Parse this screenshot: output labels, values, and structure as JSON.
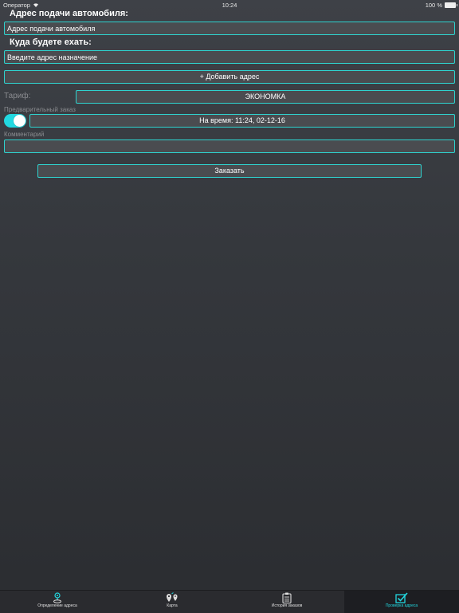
{
  "status_bar": {
    "carrier": "Оператор",
    "time": "10:24",
    "battery": "100 %"
  },
  "form": {
    "pickup_label": "Адрес подачи автомобиля:",
    "pickup_placeholder": "Адрес подачи автомобиля",
    "destination_label": "Куда будете ехать:",
    "destination_placeholder": "Введите адрес назначение",
    "add_address_label": "+ Добавить адрес",
    "tariff_label": "Тариф:",
    "tariff_value": "ЭКОНОМКА",
    "preorder_label": "Предварительный заказ",
    "preorder_enabled": true,
    "time_button_label": "На время: 11:24, 02-12-16",
    "comment_label": "Комментарий",
    "comment_value": "",
    "order_button_label": "Заказать"
  },
  "tabs": [
    {
      "label": "Определение адреса",
      "icon": "location-pin-icon",
      "active": false
    },
    {
      "label": "Карта",
      "icon": "map-pins-icon",
      "active": false
    },
    {
      "label": "История заказов",
      "icon": "clipboard-icon",
      "active": false
    },
    {
      "label": "Проверка адреса",
      "icon": "checkbox-icon",
      "active": true
    }
  ],
  "colors": {
    "accent": "#22d8e0",
    "border": "#2fd3cf",
    "field_bg": "#4a4c50",
    "tabbar_bg": "#2a2b2f"
  }
}
